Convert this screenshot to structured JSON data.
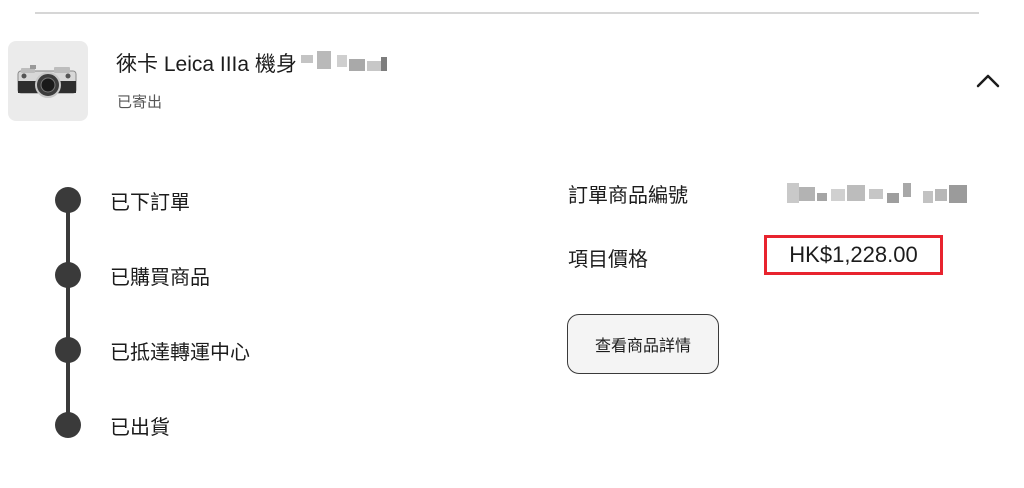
{
  "product": {
    "title": "徠卡 Leica IIIa 機身",
    "status": "已寄出",
    "thumbnail_icon": "camera-icon",
    "collapse_icon": "chevron-up-icon"
  },
  "timeline": {
    "steps": [
      {
        "label": "已下訂單"
      },
      {
        "label": "已購買商品"
      },
      {
        "label": "已抵達轉運中心"
      },
      {
        "label": "已出貨"
      }
    ]
  },
  "details": {
    "item_id_label": "訂單商品編號",
    "price_label": "項目價格",
    "price_value": "HK$1,228.00",
    "view_details_button": "查看商品詳情"
  },
  "colors": {
    "highlight_border": "#e8232e",
    "timeline": "#3a3a3a"
  }
}
